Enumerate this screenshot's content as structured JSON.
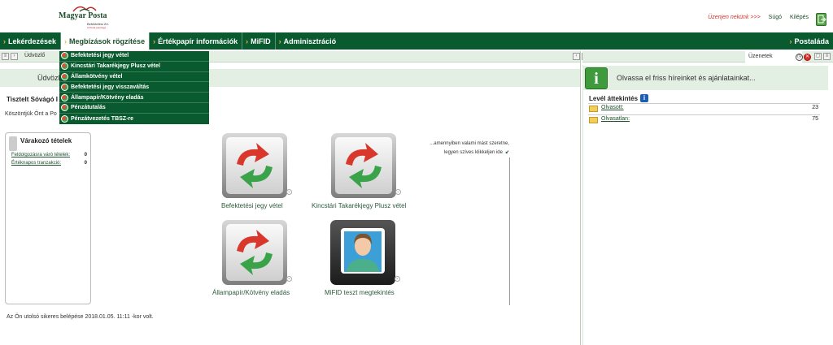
{
  "brand": {
    "logo_name": "Magyar Posta",
    "logo_sub": "Befektetési Zrt.",
    "logo_sub2": "A Posta pénzügyi..."
  },
  "header": {
    "message_link": "Üzenjen nekünk >>>",
    "help": "Súgó",
    "logout": "Kilépés",
    "logout_icon": "exit-icon"
  },
  "nav": {
    "items": [
      {
        "label": "Lekérdezések"
      },
      {
        "label": "Megbízások rögzítése",
        "active": true
      },
      {
        "label": "Értékpapír információk"
      },
      {
        "label": "MiFID"
      },
      {
        "label": "Adminisztráció"
      }
    ],
    "right_item": {
      "label": "Postaláda"
    }
  },
  "tabs": {
    "left_tab": "Üdvözlő",
    "right_tab": "Üzenetek"
  },
  "dropdown": {
    "items": [
      "Befektetési jegy vétel",
      "Kincstári Takarékjegy Plusz vétel",
      "Államkötvény vétel",
      "Befektetési jegy visszaváltás",
      "Állampapír/Kötvény eladás",
      "Pénzátutalás",
      "Pénzátvezetés TBSZ-re"
    ]
  },
  "welcome": {
    "bar_text": "Üdvözl",
    "greeting": "Tisztelt  Sóvágó I",
    "message": "Köszöntjük Önt a Po"
  },
  "waiting": {
    "title": "Várakozó tételek",
    "rows": [
      {
        "label": "Feldolgozásra váró tételek:",
        "value": "0"
      },
      {
        "label": "Értéknapos tranzakció:",
        "value": "0"
      }
    ]
  },
  "hint": {
    "line1": "...amennyiben valami mást szeretne,",
    "line2": "legyen szíves klikkeljen ide"
  },
  "tiles": [
    {
      "label": "Befektetési jegy vétel",
      "icon": "refresh-arrows-icon"
    },
    {
      "label": "Kincstári Takarékjegy Plusz vétel",
      "icon": "refresh-arrows-icon"
    },
    {
      "label": "Állampapír/Kötvény eladás",
      "icon": "refresh-arrows-icon"
    },
    {
      "label": "MiFID teszt megtekintés",
      "icon": "user-portrait-icon"
    }
  ],
  "last_login": "Az Ön utolsó sikeres belépése 2018.01.05. 11:11 -kor volt.",
  "news": {
    "text": "Olvassa el friss híreinket és ajánlatainkat..."
  },
  "mail": {
    "title": "Levél áttekintés",
    "rows": [
      {
        "label": "Olvasott:",
        "value": "23"
      },
      {
        "label": "Olvasatlan:",
        "value": "75"
      }
    ]
  },
  "colors": {
    "brand_green": "#0a5a2f",
    "accent_orange": "#f3b43b",
    "light_green": "#e4efe4",
    "alert_red": "#d4312b"
  }
}
